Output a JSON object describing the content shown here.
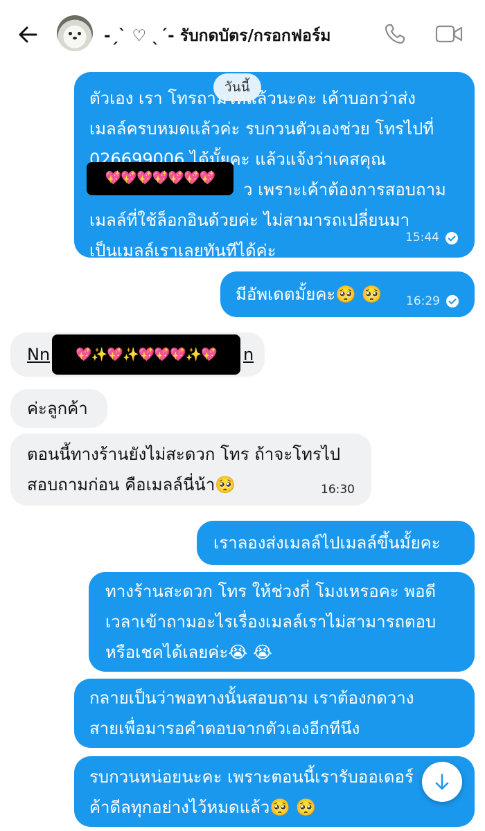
{
  "header": {
    "contact_name": "-ˏˋ ♡ ˎˊ- รับกดบัตร/กรอกฟอร์ม"
  },
  "date_label": "วันนี้",
  "messages": [
    {
      "line1": "ตัวเอง เรา โทรถามให้แล้วนะคะ เค้าบอกว่าส่ง",
      "line2": "เมลล์ครบหมดแล้วค่ะ รบกวนตัวเองช่วย โทรไปที่",
      "phone": "026699006",
      "line3_rest": " ได้มั้ยคะ แล้วแจ้งว่าเคสคุณ",
      "line4": "ว เพราะเค้าต้องการสอบถาม",
      "line5": "เมลล์ที่ใช้ล็อกอินด้วยค่ะ ไม่สามารถเปลี่ยนมา",
      "line6": "เป็นเมลล์เราเลยทันทีได้ค่ะ",
      "redacted": "💖💖💖💖💖💖💖",
      "time": "15:44"
    },
    {
      "text": "มีอัพเดตมั้ยคะ🥺 🥺",
      "time": "16:29"
    },
    {
      "prefix": "Nn",
      "suffix": "n",
      "redacted": "💖✨💖✨💖💖💖✨💖"
    },
    {
      "text": "ค่ะลูกค้า"
    },
    {
      "line1": "ตอนนี้ทางร้านยังไม่สะดวก โทร ถ้าจะโทรไป",
      "line2": "สอบถามก่อน คือเมลล์นี่น้า🥺",
      "time": "16:30"
    },
    {
      "text": "เราลองส่งเมลล์ไปเมลล์ขึ้นมั้ยคะ"
    },
    {
      "line1": "ทางร้านสะดวก โทร ให้ช่วงกี่ โมงเหรอคะ พอดี",
      "line2": "เวลาเข้าถามอะไรเรื่องเมลล์เราไม่สามารถตอบ",
      "line3": "หรือเชคได้เลยค่ะ😭 😭"
    },
    {
      "line1": "กลายเป็นว่าพอทางนั้นสอบถาม เราต้องกดวาง",
      "line2": "สายเพื่อมารอคำตอบจากตัวเองอีกทีนึง"
    },
    {
      "line1": "รบกวนหน่อยนะคะ เพราะตอนนี้เรารับออเดอร์",
      "line2": "ค้าดีลทุกอย่างไว้หมดแล้ว🥺 🥺"
    }
  ],
  "colors": {
    "outgoing": "#1a98ee",
    "incoming": "#f0f1f3",
    "background": "#ffffff"
  }
}
